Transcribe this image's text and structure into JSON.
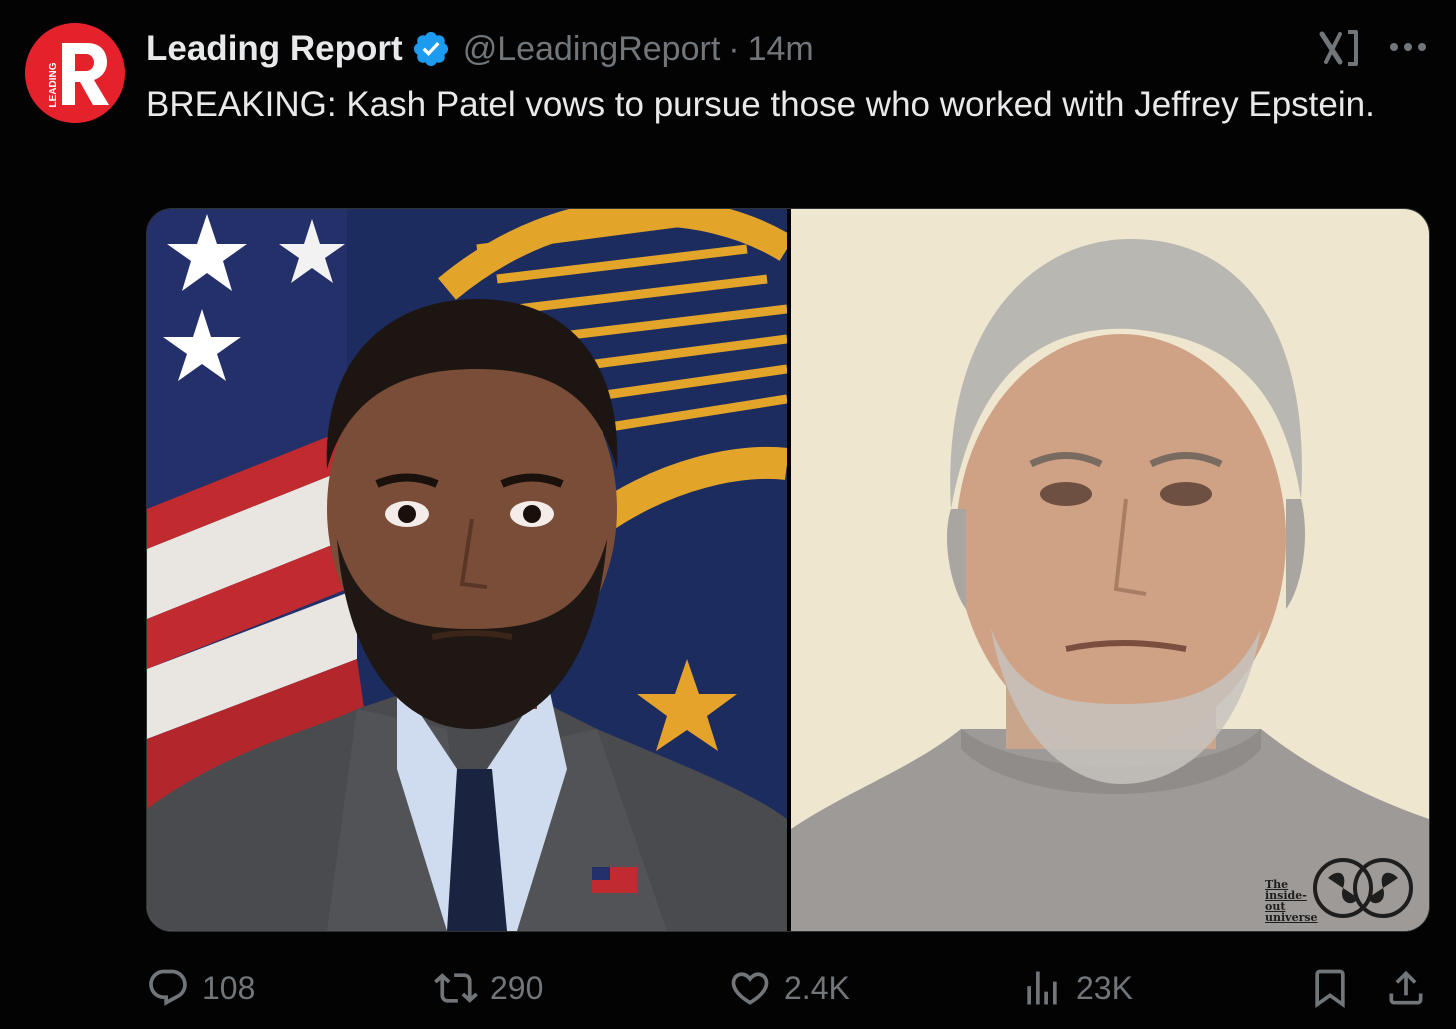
{
  "account": {
    "display_name": "Leading Report",
    "handle": "@LeadingReport",
    "separator": "·",
    "time_ago": "14m",
    "verified": true,
    "avatar_letter": "R",
    "avatar_side_text": "LEADING",
    "avatar_color": "#e5212b"
  },
  "tweet": {
    "text": "BREAKING: Kash Patel vows to pursue those who worked with Jeffrey Epstein."
  },
  "media": {
    "watermark_text": "The inside-out universe"
  },
  "actions": {
    "replies": "108",
    "reposts": "290",
    "likes": "2.4K",
    "views": "23K"
  },
  "icons": {
    "reply": "reply-icon",
    "repost": "repost-icon",
    "like": "heart-icon",
    "views": "views-icon",
    "bookmark": "bookmark-icon",
    "share": "share-icon",
    "grok": "grok-icon",
    "more": "more-icon",
    "verified": "verified-badge-icon"
  },
  "colors": {
    "background": "#030303",
    "text": "#e7e9ea",
    "muted": "#71767b",
    "verified": "#1d9bf0",
    "brand_red": "#e5212b"
  }
}
